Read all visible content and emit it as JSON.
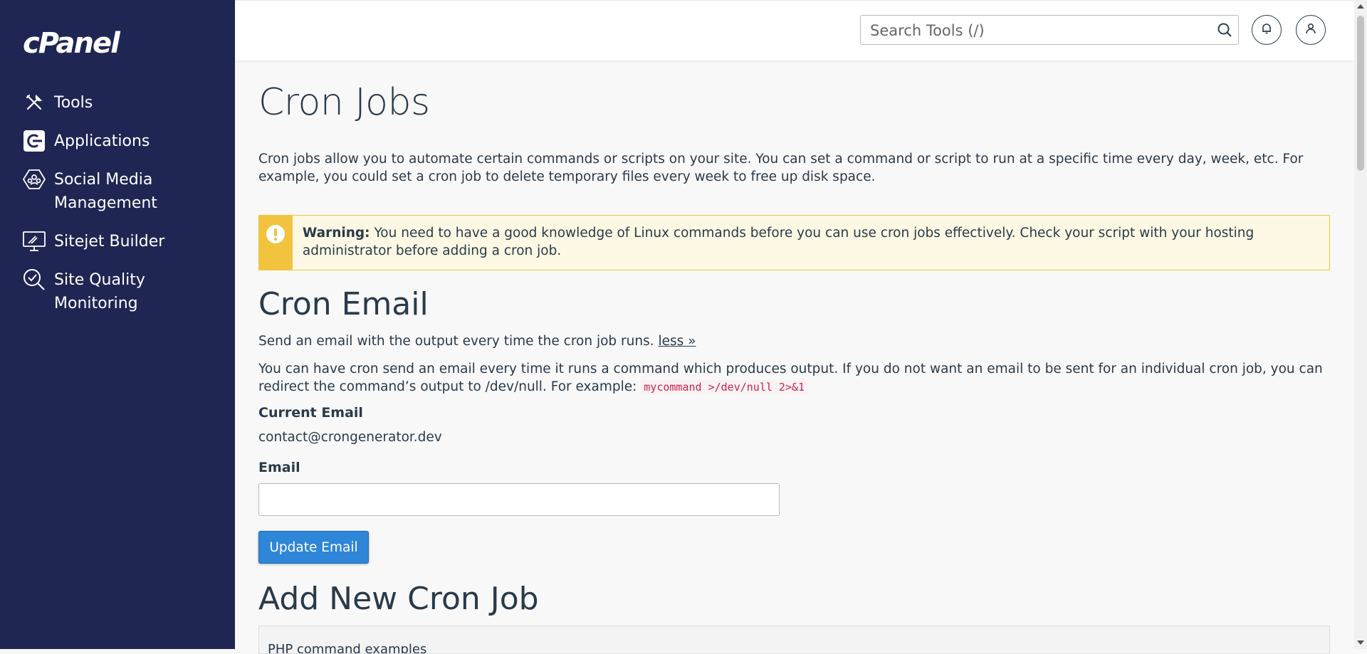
{
  "sidebar": {
    "logo_text": "cPanel",
    "items": [
      {
        "label": "Tools",
        "icon": "tools-icon"
      },
      {
        "label": "Applications",
        "icon": "applications-icon"
      },
      {
        "label": "Social Media Management",
        "icon": "social-media-icon"
      },
      {
        "label": "Sitejet Builder",
        "icon": "sitejet-icon"
      },
      {
        "label": "Site Quality Monitoring",
        "icon": "site-quality-icon"
      }
    ]
  },
  "header": {
    "search_placeholder": "Search Tools (/)",
    "notifications_icon": "bell-icon",
    "user_icon": "user-icon"
  },
  "main": {
    "title": "Cron Jobs",
    "intro": "Cron jobs allow you to automate certain commands or scripts on your site. You can set a command or script to run at a specific time every day, week, etc. For example, you could set a cron job to delete temporary files every week to free up disk space.",
    "warning": {
      "label": "Warning:",
      "text": "You need to have a good knowledge of Linux commands before you can use cron jobs effectively. Check your script with your hosting administrator before adding a cron job."
    },
    "cron_email": {
      "heading": "Cron Email",
      "summary": "Send an email with the output every time the cron job runs.",
      "less_link": "less »",
      "details": "You can have cron send an email every time it runs a command which produces output. If you do not want an email to be sent for an individual cron job, you can redirect the command’s output to /dev/null. For example:",
      "example_command": "mycommand >/dev/null 2>&1",
      "current_email_label": "Current Email",
      "current_email_value": "contact@crongenerator.dev",
      "email_label": "Email",
      "email_value": "",
      "update_button": "Update Email"
    },
    "add_job": {
      "heading": "Add New Cron Job",
      "panel_text": "PHP command examples"
    }
  },
  "colors": {
    "sidebar_bg": "#1f2653",
    "primary_button": "#2e86d8",
    "warning_bg": "#fcf8e3",
    "warning_accent": "#f1c33e"
  }
}
